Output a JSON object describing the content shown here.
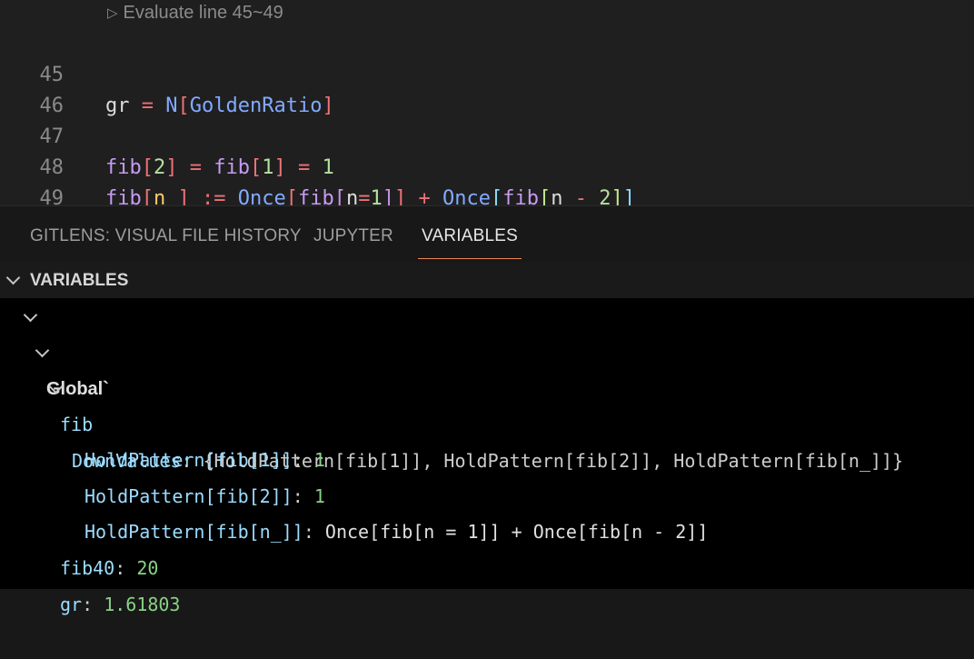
{
  "editor": {
    "codelens": "Evaluate line 45~49",
    "lines": [
      {
        "num": "45"
      },
      {
        "num": "46"
      },
      {
        "num": "47"
      },
      {
        "num": "48"
      },
      {
        "num": "49"
      }
    ]
  },
  "tabs": [
    {
      "label": "GITLENS: VISUAL FILE HISTORY"
    },
    {
      "label": "JUPYTER"
    },
    {
      "label": "VARIABLES",
      "active": true
    }
  ],
  "variables": {
    "section_title": "VARIABLES",
    "scope": "Global`",
    "fib": {
      "name": "fib",
      "downvalues_name": "DownValues",
      "downvalues_value": "{HoldPattern[fib[1]], HoldPattern[fib[2]], HoldPattern[fib[n_]]}",
      "entries": [
        {
          "name": "HoldPattern[fib[1]]",
          "value": "1"
        },
        {
          "name": "HoldPattern[fib[2]]",
          "value": "1"
        },
        {
          "name": "HoldPattern[fib[n_]]",
          "value": "Once[fib[n = 1]] + Once[fib[n - 2]]"
        }
      ]
    },
    "fib40": {
      "name": "fib40",
      "value": "20"
    },
    "gr": {
      "name": "gr",
      "value": "1.61803"
    }
  },
  "colors": {
    "accent_tab_underline": "#e8895a",
    "variable_name": "#9cdcfe",
    "number_value": "#89d185"
  }
}
